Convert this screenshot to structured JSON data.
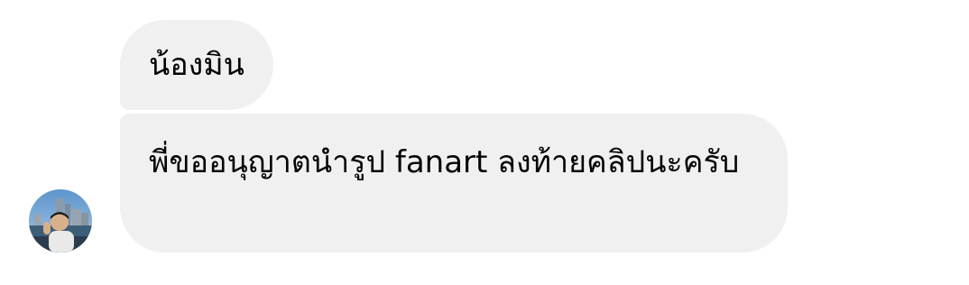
{
  "messages": [
    {
      "text": "น้องมิน"
    },
    {
      "text": "พี่ขออนุญาตนำรูป fanart ลงท้ายคลิปนะครับ"
    }
  ],
  "sender": {
    "avatar_icon": "user-avatar-photo"
  }
}
